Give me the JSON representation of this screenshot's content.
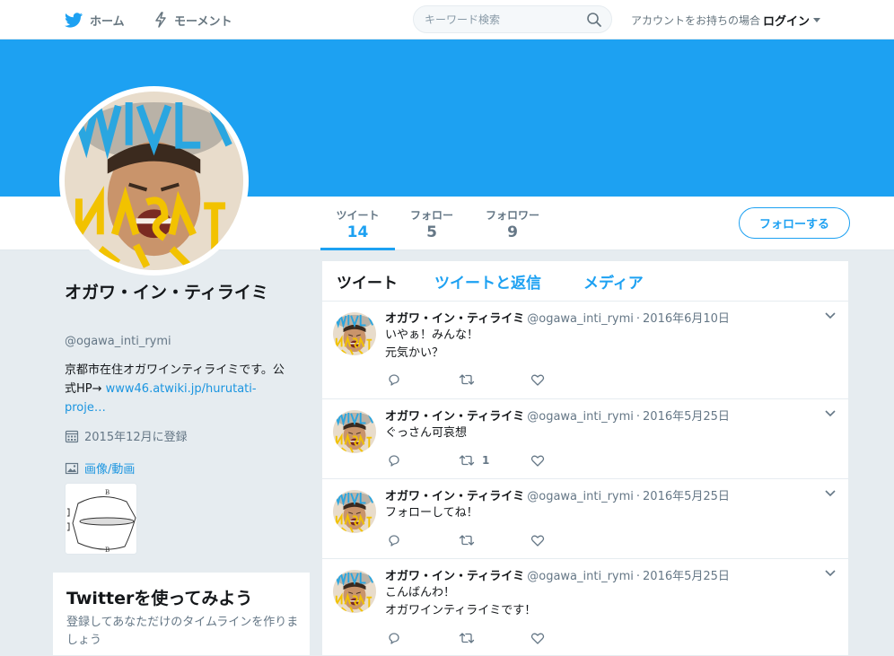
{
  "nav": {
    "home_label": "ホーム",
    "moments_label": "モーメント",
    "search_placeholder": "キーワード検索",
    "login_prompt": "アカウントをお持ちの場合",
    "login_label": "ログイン"
  },
  "profile": {
    "name": "オガワ・イン・ティライミ",
    "handle": "@ogawa_inti_rymi",
    "bio_text": "京都市在住オガワインティライミです。公式HP→ ",
    "bio_link": "www46.atwiki.jp/hurutati-proje…",
    "joined": "2015年12月に登録",
    "media_label": "画像/動画",
    "follow_button": "フォローする"
  },
  "stats": {
    "tweets_label": "ツイート",
    "tweets_value": "14",
    "following_label": "フォロー",
    "following_value": "5",
    "followers_label": "フォロワー",
    "followers_value": "9"
  },
  "signup": {
    "title": "Twitterを使ってみよう",
    "description": "登録してあなただけのタイムラインを作りましょう"
  },
  "tabs": {
    "tweets": "ツイート",
    "tweets_replies": "ツイートと返信",
    "media": "メディア"
  },
  "tweets": [
    {
      "name": "オガワ・イン・ティライミ",
      "handle": "@ogawa_inti_rymi",
      "dot": "·",
      "date": "2016年6月10日",
      "line1": "いやぁ！みんな！",
      "line2": "元気かい？",
      "retweets": ""
    },
    {
      "name": "オガワ・イン・ティライミ",
      "handle": "@ogawa_inti_rymi",
      "dot": "·",
      "date": "2016年5月25日",
      "line1": "ぐっさん可哀想",
      "line2": "",
      "retweets": "1"
    },
    {
      "name": "オガワ・イン・ティライミ",
      "handle": "@ogawa_inti_rymi",
      "dot": "·",
      "date": "2016年5月25日",
      "line1": "フォローしてね！",
      "line2": "",
      "retweets": ""
    },
    {
      "name": "オガワ・イン・ティライミ",
      "handle": "@ogawa_inti_rymi",
      "dot": "·",
      "date": "2016年5月25日",
      "line1": "こんばんわ！",
      "line2": "オガワインティライミです！",
      "retweets": ""
    }
  ],
  "colors": {
    "accent": "#1da1f2",
    "background": "#e6ecf0"
  }
}
